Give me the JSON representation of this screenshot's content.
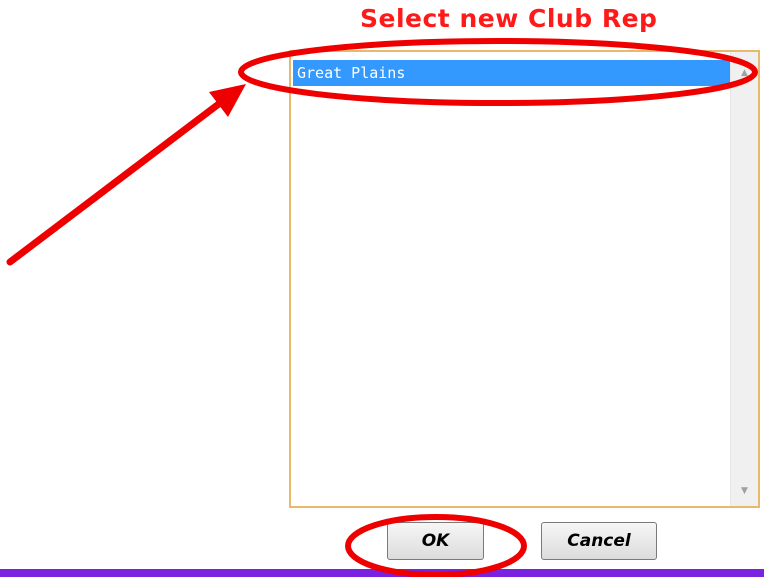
{
  "dialog": {
    "title": "Select new Club Rep",
    "list": {
      "items": [
        "Great Plains"
      ],
      "selected_index": 0
    },
    "ok_label": "OK",
    "cancel_label": "Cancel"
  },
  "scrollbar": {
    "up_arrow": "▲",
    "down_arrow": "▼"
  },
  "colors": {
    "title": "#ff1a1a",
    "selection": "#3399ff",
    "list_border": "#e8b86d",
    "annotation": "#ee0000",
    "bottom_bar": "#7a22e0"
  }
}
